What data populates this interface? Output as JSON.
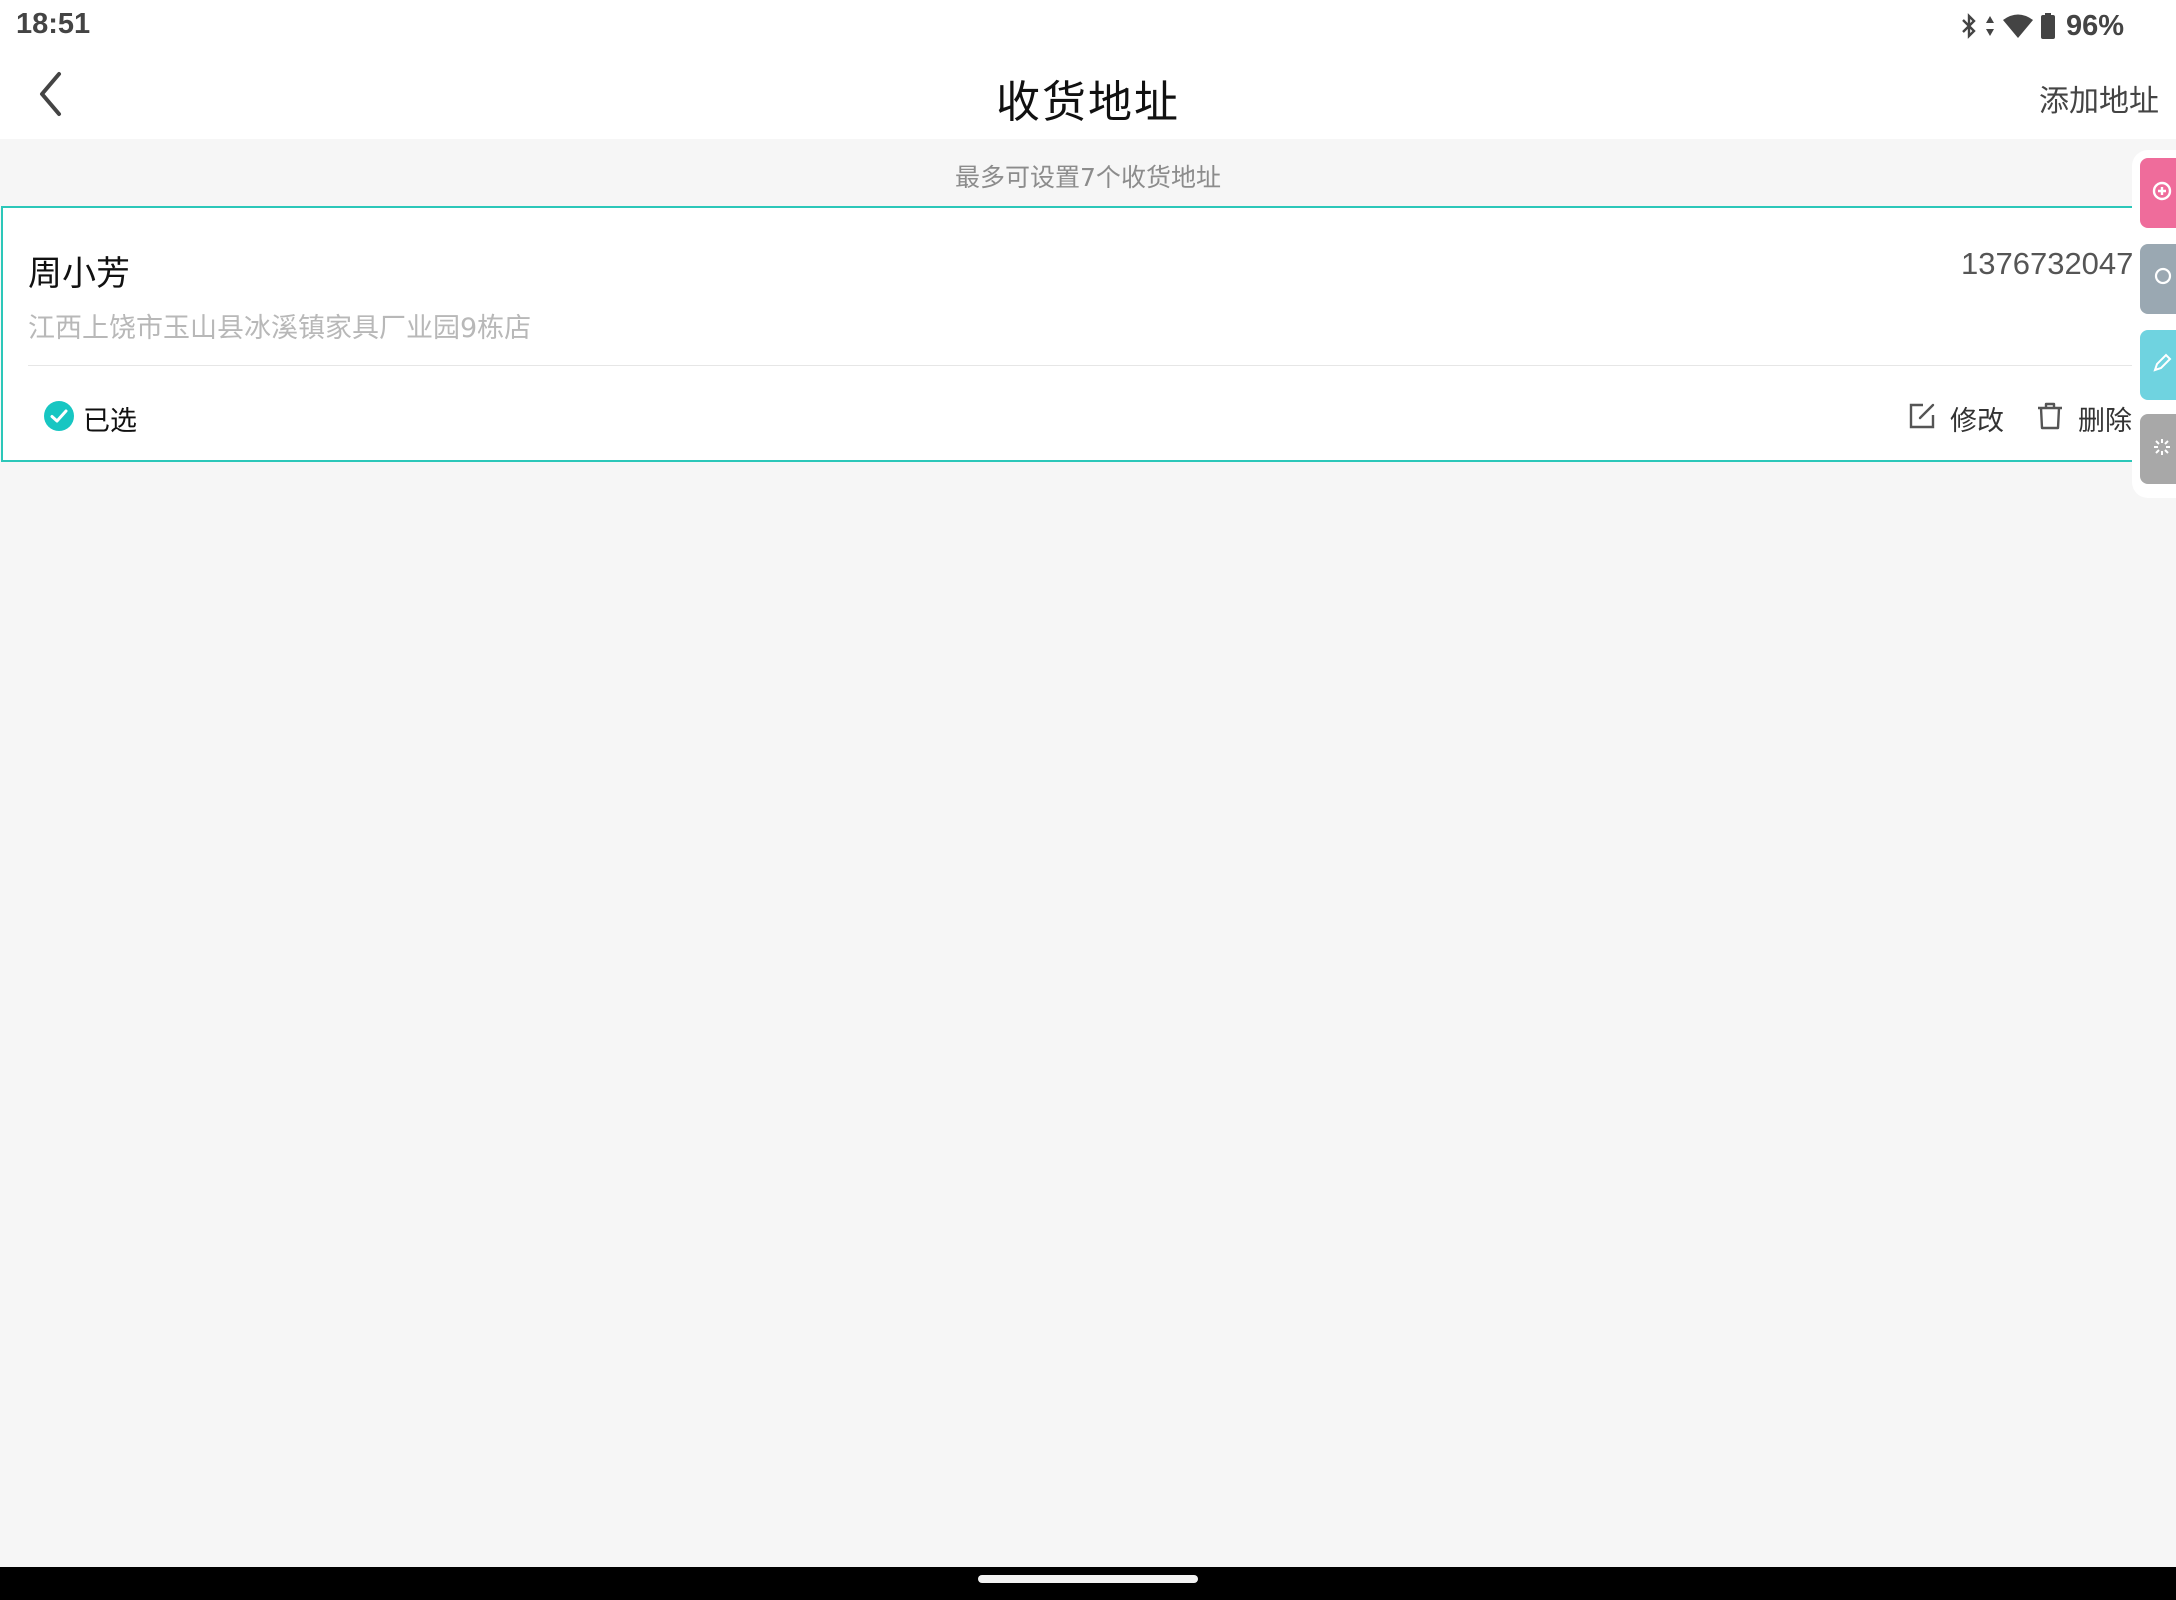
{
  "status_bar": {
    "time": "18:51",
    "battery": "96%",
    "icons": [
      "bluetooth-icon",
      "data-arrows-icon",
      "wifi-icon",
      "battery-icon"
    ]
  },
  "header": {
    "title": "收货地址",
    "add_address_label": "添加地址",
    "back_icon": "chevron-left-icon"
  },
  "hint": "最多可设置7个收货地址",
  "addresses": [
    {
      "name": "周小芳",
      "phone": "13767320477",
      "address": "江西上饶市玉山县冰溪镇家具厂业园9栋店",
      "selected_label": "已选",
      "edit_label": "修改",
      "delete_label": "删除"
    }
  ],
  "side_dock": {
    "buttons": [
      "add-circle-icon",
      "search-icon",
      "pen-icon",
      "sparkle-icon"
    ],
    "colors": [
      "#ef6c9b",
      "#9aa8b2",
      "#6fd3e0",
      "#a8a8a8"
    ]
  },
  "colors": {
    "accent": "#2cc7b9",
    "background": "#f6f6f6"
  }
}
